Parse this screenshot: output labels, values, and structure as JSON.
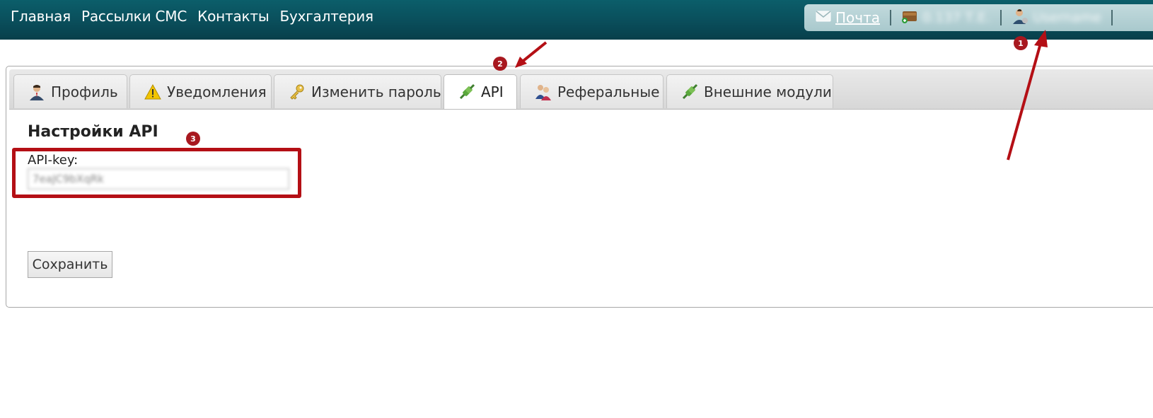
{
  "nav": {
    "items": [
      "Главная",
      "Рассылки СМС",
      "Контакты",
      "Бухгалтерия"
    ]
  },
  "userpanel": {
    "mail_label": "Почта",
    "mail_icon": "envelope-icon",
    "wallet_icon": "wallet-icon",
    "user_icon": "user-icon"
  },
  "tabs": [
    {
      "label": "Профиль",
      "icon": "profile-icon"
    },
    {
      "label": "Уведомления",
      "icon": "warning-icon"
    },
    {
      "label": "Изменить пароль",
      "icon": "key-icon"
    },
    {
      "label": "API",
      "icon": "plug-icon",
      "active": true
    },
    {
      "label": "Реферальные",
      "icon": "referral-icon"
    },
    {
      "label": "Внешние модули",
      "icon": "plug-icon"
    }
  ],
  "api_settings": {
    "title": "Настройки API",
    "key_label": "API-key:"
  },
  "actions": {
    "save_label": "Сохранить"
  },
  "annotations": {
    "badge_1": "1",
    "badge_2": "2",
    "badge_3": "3",
    "color": "#b40f15"
  },
  "colors": {
    "topbar": "#0a4e5b",
    "userpanel": "#b7d3d6",
    "accent_red": "#a8181f"
  }
}
